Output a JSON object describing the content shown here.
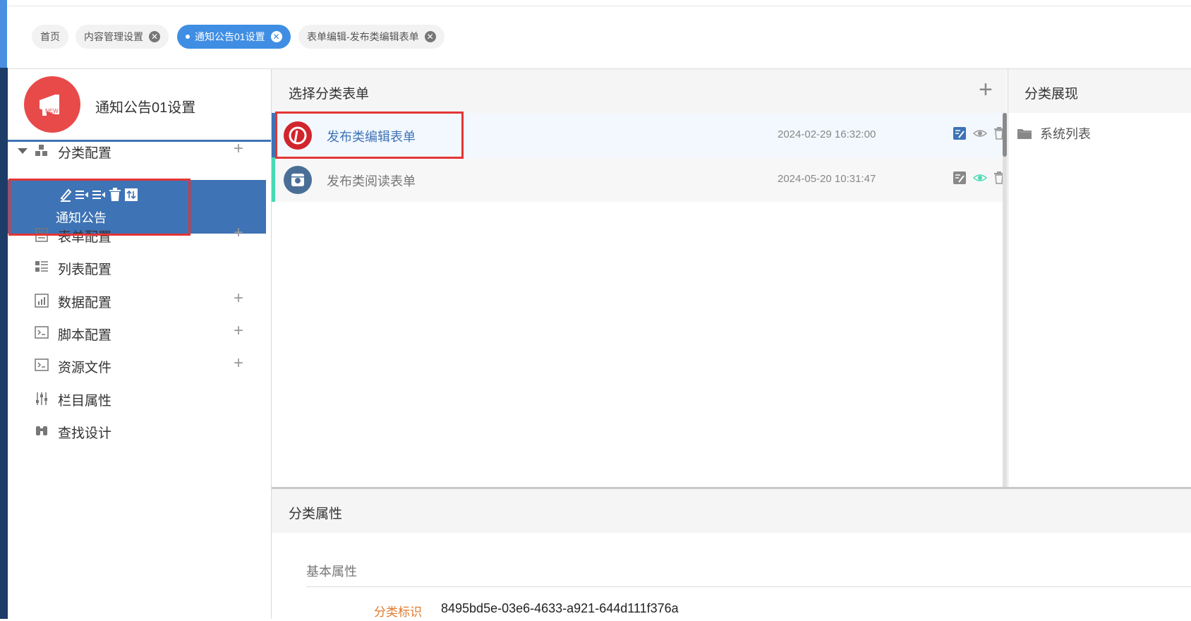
{
  "tabs": [
    {
      "label": "首页"
    },
    {
      "label": "内容管理设置"
    },
    {
      "label": "通知公告01设置"
    },
    {
      "label": "表单编辑-发布类编辑表单"
    }
  ],
  "sidebar": {
    "logo_text": "NEW",
    "title": "通知公告01设置",
    "items": [
      {
        "label": "分类配置",
        "plus": "+"
      },
      {
        "label": "通知公告"
      },
      {
        "label": "表单配置",
        "plus": "+"
      },
      {
        "label": "列表配置"
      },
      {
        "label": "数据配置",
        "plus": "+"
      },
      {
        "label": "脚本配置",
        "plus": "+"
      },
      {
        "label": "资源文件",
        "plus": "+"
      },
      {
        "label": "栏目属性"
      },
      {
        "label": "查找设计"
      }
    ]
  },
  "forms_panel": {
    "title": "选择分类表单",
    "add": "+",
    "rows": [
      {
        "name": "发布类编辑表单",
        "date": "2024-02-29 16:32:00"
      },
      {
        "name": "发布类阅读表单",
        "date": "2024-05-20 10:31:47"
      }
    ]
  },
  "display_panel": {
    "title": "分类展现",
    "item": "系统列表"
  },
  "properties": {
    "title": "分类属性",
    "section": "基本属性",
    "label": "分类标识",
    "value": "8495bd5e-03e6-4633-a921-644d111f376a"
  },
  "colors": {
    "accent": "#3e73b5",
    "active_tab": "#3f8ee3",
    "highlight": "#e43535",
    "teal": "#47d9b4"
  }
}
